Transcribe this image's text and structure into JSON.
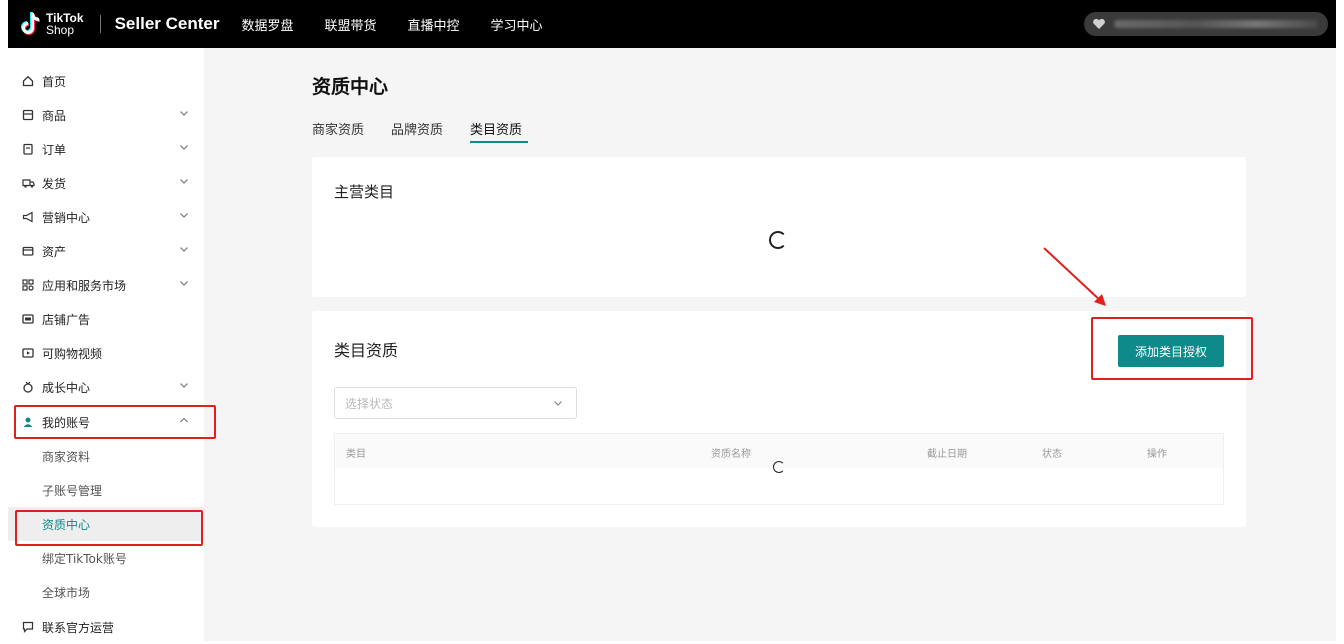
{
  "header": {
    "logo_top": "TikTok",
    "logo_bottom": "Shop",
    "brand": "Seller Center",
    "nav": [
      "数据罗盘",
      "联盟带货",
      "直播中控",
      "学习中心"
    ]
  },
  "sidebar": {
    "items": [
      {
        "label": "首页",
        "icon": "home-icon"
      },
      {
        "label": "商品",
        "icon": "product-icon"
      },
      {
        "label": "订单",
        "icon": "order-icon"
      },
      {
        "label": "发货",
        "icon": "truck-icon"
      },
      {
        "label": "营销中心",
        "icon": "megaphone-icon"
      },
      {
        "label": "资产",
        "icon": "wallet-icon"
      },
      {
        "label": "应用和服务市场",
        "icon": "apps-icon"
      },
      {
        "label": "店铺广告",
        "icon": "ad-icon"
      },
      {
        "label": "可购物视频",
        "icon": "video-icon"
      },
      {
        "label": "成长中心",
        "icon": "growth-icon"
      },
      {
        "label": "我的账号",
        "icon": "user-icon"
      }
    ],
    "sub_items": [
      "商家资料",
      "子账号管理",
      "资质中心",
      "绑定TikTok账号",
      "全球市场"
    ],
    "footer_item": {
      "label": "联系官方运营",
      "icon": "chat-icon"
    }
  },
  "main": {
    "title": "资质中心",
    "tabs": [
      "商家资质",
      "品牌资质",
      "类目资质"
    ],
    "active_tab": "类目资质",
    "card1_title": "主营类目",
    "card2_title": "类目资质",
    "add_button": "添加类目授权",
    "select_placeholder": "选择状态",
    "table_headers": [
      "类目",
      "资质名称",
      "截止日期",
      "状态",
      "操作"
    ]
  },
  "colors": {
    "accent": "#0f8a8a",
    "highlight": "#e0201f"
  }
}
